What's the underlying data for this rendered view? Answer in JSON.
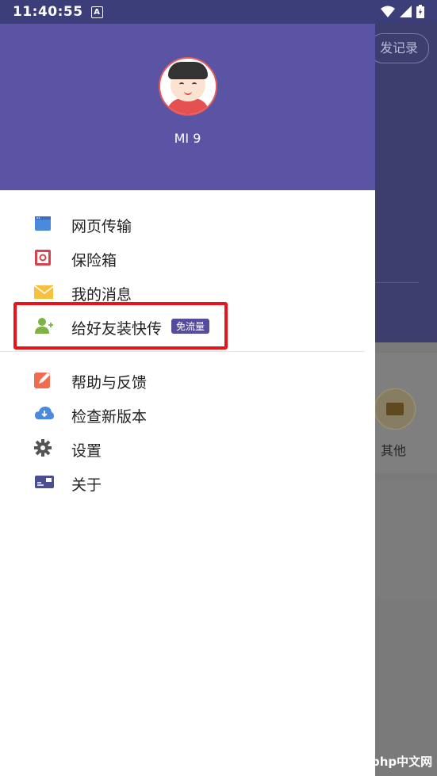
{
  "status_bar": {
    "time": "11:40:55",
    "notif_icon": "A"
  },
  "background_app": {
    "pill_label": "发记录",
    "other_label": "其他"
  },
  "drawer": {
    "device_name": "MI 9",
    "menu_group1": [
      {
        "label": "网页传输",
        "icon": "browser-icon"
      },
      {
        "label": "保险箱",
        "icon": "safe-icon"
      },
      {
        "label": "我的消息",
        "icon": "mail-icon"
      },
      {
        "label": "给好友装快传",
        "icon": "add-friend-icon",
        "badge": "免流量"
      }
    ],
    "menu_group2": [
      {
        "label": "帮助与反馈",
        "icon": "edit-feedback-icon"
      },
      {
        "label": "检查新版本",
        "icon": "cloud-download-icon"
      },
      {
        "label": "设置",
        "icon": "gear-icon"
      },
      {
        "label": "关于",
        "icon": "id-card-icon"
      }
    ]
  },
  "watermark": "php中文网",
  "colors": {
    "header": "#5b53a4",
    "highlight": "#e8141a",
    "badge": "#554c9e"
  }
}
